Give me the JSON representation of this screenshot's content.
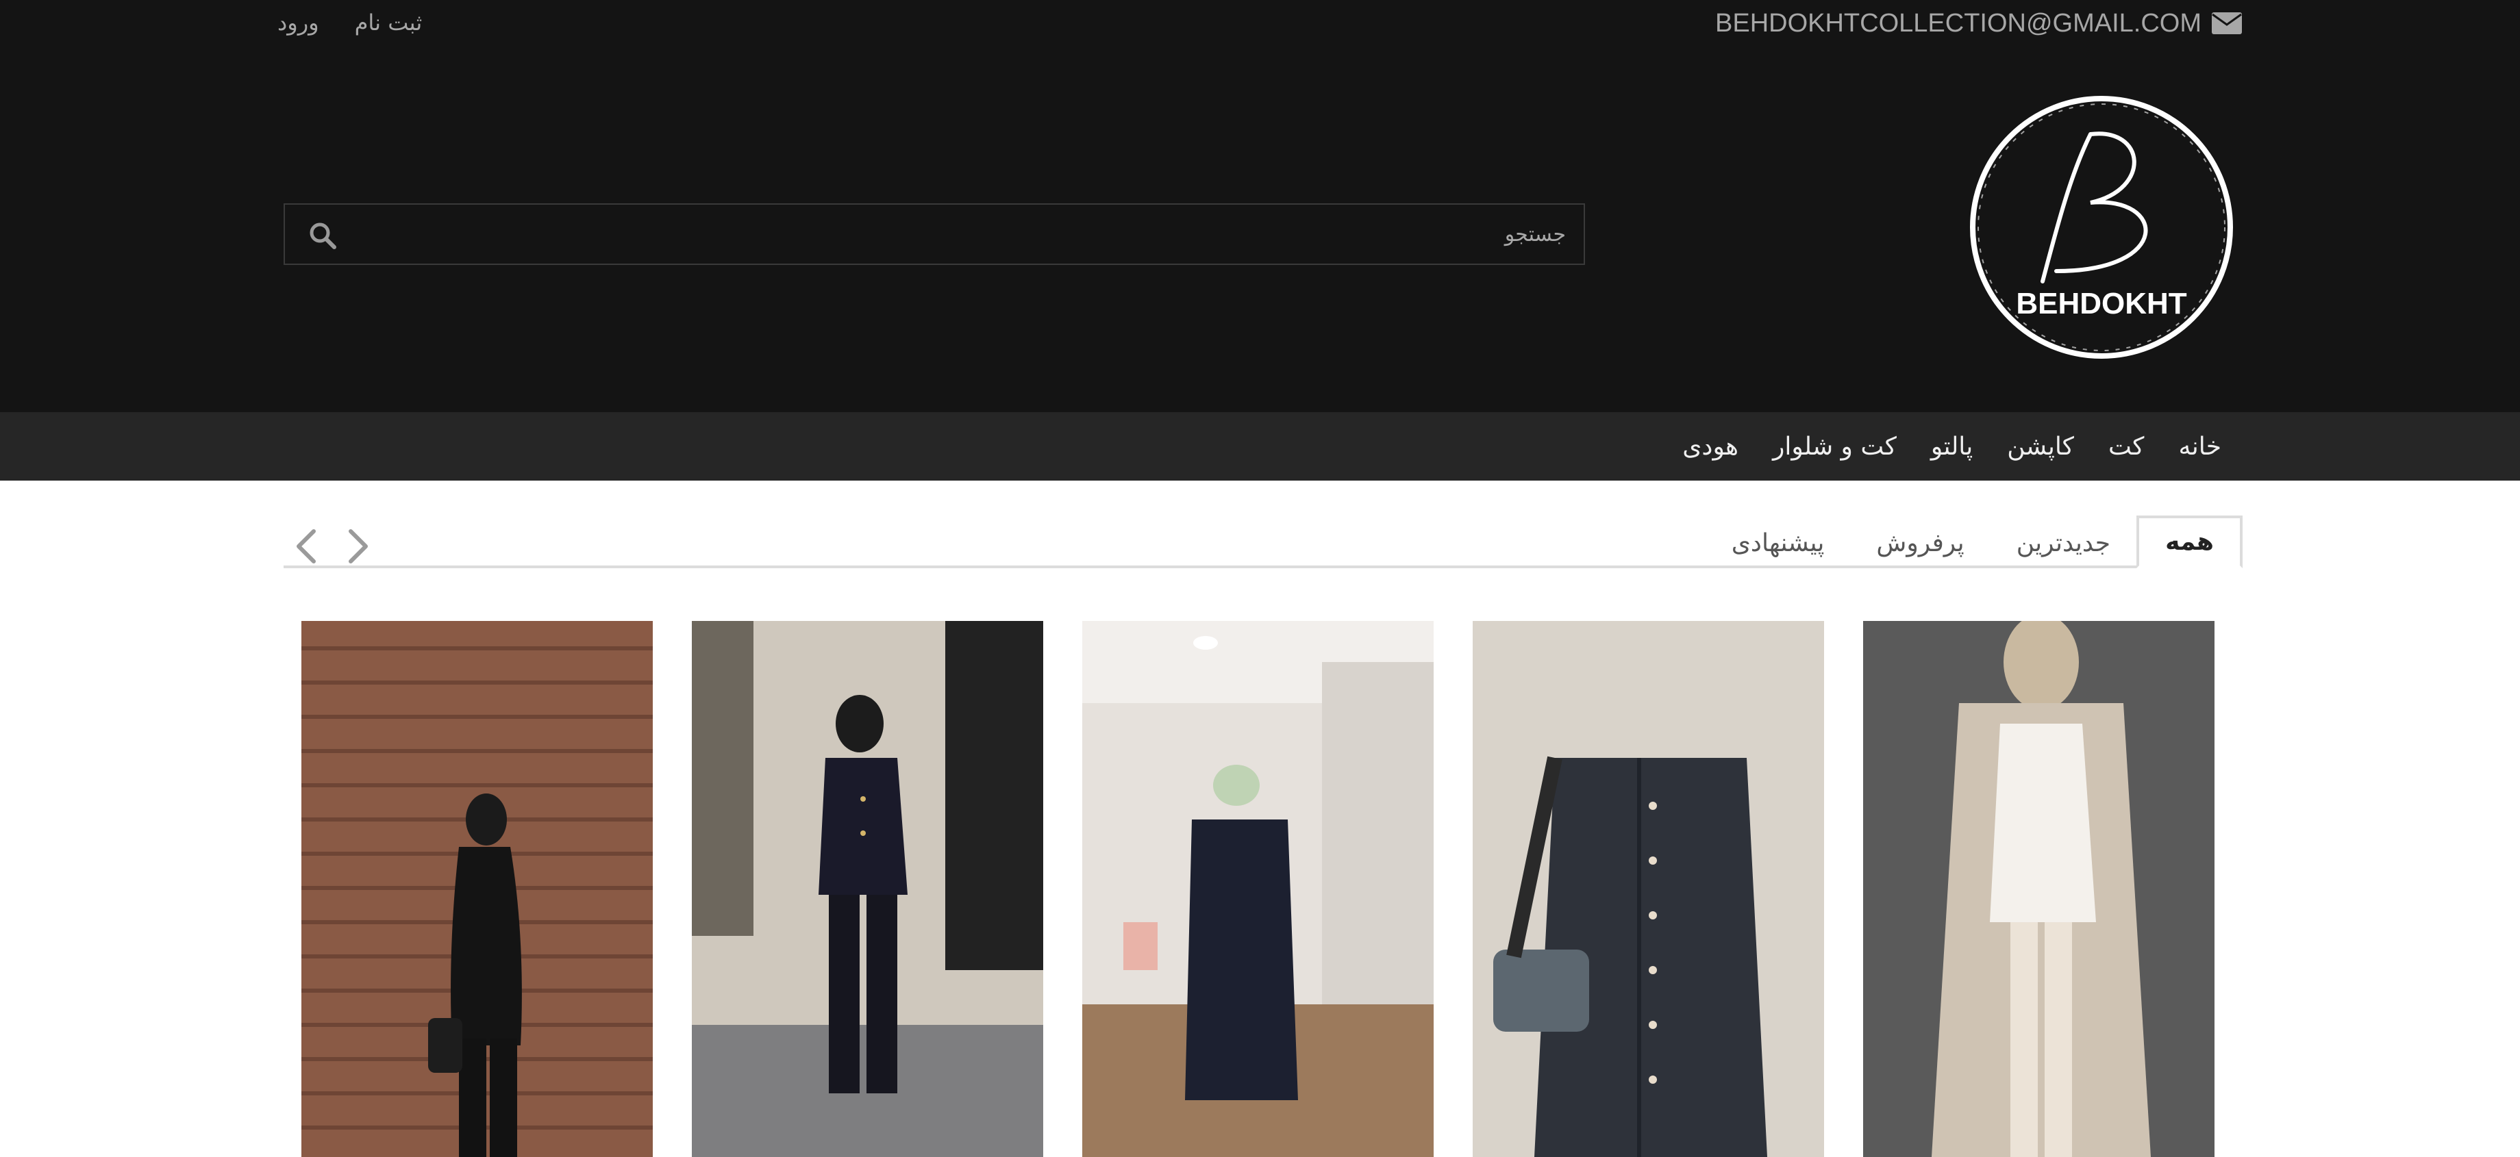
{
  "header": {
    "email": "BEHDOKHTCOLLECTION@GMAIL.COM",
    "login_label": "ورود",
    "register_label": "ثبت نام",
    "logo_text": "BEHDOKHT",
    "search_placeholder": "جستجو"
  },
  "nav": {
    "items": [
      "خانه",
      "کت",
      "کاپشن",
      "پالتو",
      "کت و شلوار",
      "هودی"
    ]
  },
  "tabs": {
    "items": [
      "همه",
      "جدیدترین",
      "پرفروش",
      "پیشنهادی"
    ],
    "active_index": 0
  },
  "colors": {
    "header_bg": "#141414",
    "navbar_bg": "#262626",
    "text_muted": "#a7a7a7"
  },
  "products": [
    {
      "icon": "product-photo-beige-coat"
    },
    {
      "icon": "product-photo-grey-set-with-bag"
    },
    {
      "icon": "product-photo-navy-long-hoodie"
    },
    {
      "icon": "product-photo-black-jacket-suit"
    },
    {
      "icon": "product-photo-black-outfit-wood-wall"
    }
  ]
}
